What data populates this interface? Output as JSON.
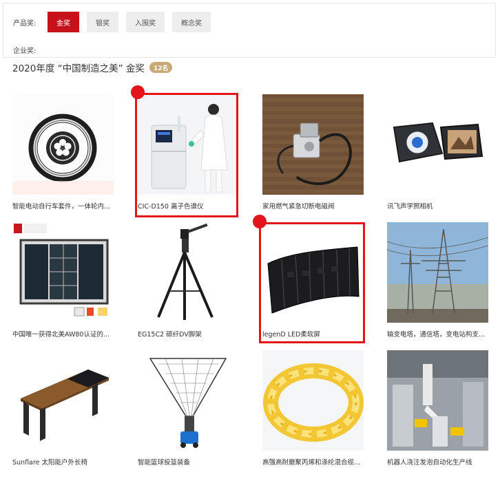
{
  "filters": {
    "product_label": "产品奖:",
    "product_options": [
      {
        "label": "金奖",
        "active": true
      },
      {
        "label": "银奖",
        "active": false
      },
      {
        "label": "入围奖",
        "active": false
      },
      {
        "label": "概念奖",
        "active": false
      }
    ],
    "company_label": "企业奖:"
  },
  "heading": {
    "title": "2020年度 “中国制造之美” 金奖",
    "count": "12名"
  },
  "products": [
    {
      "label": "智能电动自行车套件，一体轮内...",
      "icon": "ebike-wheel"
    },
    {
      "label": "CIC-D150 离子色谱仪",
      "icon": "ion-chromatograph",
      "highlighted": true
    },
    {
      "label": "家用燃气紧急切断电磁阀",
      "icon": "gas-valve"
    },
    {
      "label": "讯飞声学照相机",
      "icon": "acoustic-camera"
    },
    {
      "label": "中国唯一获得北美AW80认证的...",
      "icon": "window"
    },
    {
      "label": "EG15C2 碳纤DV脚架",
      "icon": "tripod"
    },
    {
      "label": "legenD LED柔软屏",
      "icon": "led-panel",
      "highlighted": true
    },
    {
      "label": "输变电塔，通信塔，变电站构支...",
      "icon": "power-tower"
    },
    {
      "label": "Sunflare 太阳能户外长椅",
      "icon": "solar-bench"
    },
    {
      "label": "智能篮球投篮装备",
      "icon": "basketball-machine"
    },
    {
      "label": "高强高耐磨聚丙烯和涤纶混合缆...",
      "icon": "rope"
    },
    {
      "label": "机器人浇注发泡自动化生产线",
      "icon": "robot-line"
    }
  ],
  "colors": {
    "accent": "#c5121b",
    "badge": "#c8a876",
    "highlight": "#e3141b"
  }
}
